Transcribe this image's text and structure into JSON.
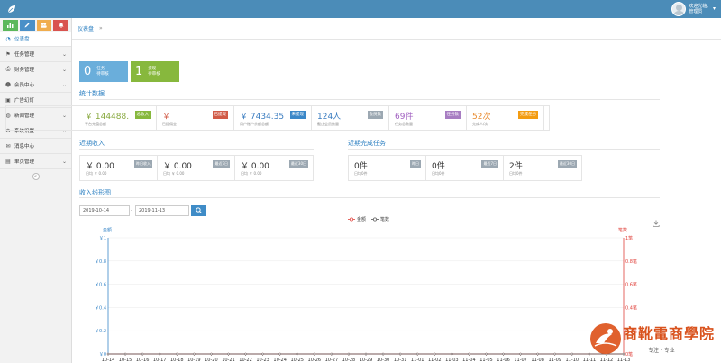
{
  "header": {
    "user_line1": "欢迎光临,",
    "user_line2": "管理员",
    "shortcuts": [
      {
        "icon": "bar-chart-icon",
        "color": "#5cb85c"
      },
      {
        "icon": "pencil-icon",
        "color": "#4a90c8"
      },
      {
        "icon": "users-icon",
        "color": "#f0ad4e"
      },
      {
        "icon": "bell-icon",
        "color": "#d9534f"
      }
    ]
  },
  "sidebar": {
    "items": [
      {
        "label": "仪表盘",
        "icon": "dashboard-icon",
        "active": true
      },
      {
        "label": "任务管理",
        "icon": "flag-icon"
      },
      {
        "label": "财务管理",
        "icon": "print-icon"
      },
      {
        "label": "会员中心",
        "icon": "user-icon"
      },
      {
        "label": "广告幻灯",
        "icon": "image-icon"
      },
      {
        "label": "新闻管理",
        "icon": "globe-icon"
      },
      {
        "label": "系统设置",
        "icon": "gear-icon"
      },
      {
        "label": "消息中心",
        "icon": "message-icon"
      },
      {
        "label": "单页管理",
        "icon": "book-icon"
      }
    ]
  },
  "breadcrumb": {
    "current": "仪表盘",
    "sep": "»"
  },
  "tiles": [
    {
      "value": "0",
      "title": "任务",
      "sub": "待审核",
      "color": "#6aaedb"
    },
    {
      "value": "1",
      "title": "提现",
      "sub": "待审核",
      "color": "#87b83d"
    }
  ],
  "stats": {
    "title": "统计数据",
    "items": [
      {
        "value": "￥ 144488.",
        "sub": "平台充值总额",
        "tag": "总收入",
        "tag_color": "#87b83d",
        "value_color": "#87a83d"
      },
      {
        "value": "￥",
        "sub": "已提佣金",
        "tag": "已提现",
        "tag_color": "#d15b47",
        "value_color": "#d15b47"
      },
      {
        "value": "￥ 7434.35",
        "sub": "用户账户余额总额",
        "tag": "未提现",
        "tag_color": "#3a87c8",
        "value_color": "#3a7cc0"
      },
      {
        "value": "124人",
        "sub": "截止会员数量",
        "tag": "会员数",
        "tag_color": "#9ca8b2",
        "value_color": "#3a7cc0"
      },
      {
        "value": "69件",
        "sub": "任务总数量",
        "tag": "任务数",
        "tag_color": "#a77dc2",
        "value_color": "#a05fc0"
      },
      {
        "value": "52次",
        "sub": "完成人/次",
        "tag": "完成任务",
        "tag_color": "#f39c12",
        "value_color": "#e8892b"
      }
    ]
  },
  "recent_income": {
    "title": "近期收入",
    "items": [
      {
        "value": "￥ 0.00",
        "sub": "日均 ￥ 0.00",
        "tag": "昨日收入"
      },
      {
        "value": "￥ 0.00",
        "sub": "日均 ￥ 0.00",
        "tag": "最近7日"
      },
      {
        "value": "￥ 0.00",
        "sub": "日均 ￥ 0.00",
        "tag": "最近30日"
      }
    ]
  },
  "recent_tasks": {
    "title": "近期完成任务",
    "items": [
      {
        "value": "0件",
        "sub": "日均0件",
        "tag": "昨日"
      },
      {
        "value": "0件",
        "sub": "日均0件",
        "tag": "最近7日"
      },
      {
        "value": "2件",
        "sub": "日均0件",
        "tag": "最近30日"
      }
    ]
  },
  "income_chart_section": {
    "title": "收入线形图",
    "date_from": "2019-10-14",
    "date_to": "2019-11-13",
    "range_sep": "-",
    "search_icon": "search-icon",
    "download_icon": "download-icon"
  },
  "chart_data": {
    "type": "line",
    "x": [
      "10-14",
      "10-15",
      "10-16",
      "10-17",
      "10-18",
      "10-19",
      "10-20",
      "10-21",
      "10-22",
      "10-23",
      "10-24",
      "10-25",
      "10-26",
      "10-27",
      "10-28",
      "10-29",
      "10-30",
      "10-31",
      "11-01",
      "11-02",
      "11-03",
      "11-04",
      "11-05",
      "11-06",
      "11-07",
      "11-08",
      "11-09",
      "11-10",
      "11-11",
      "11-12",
      "11-13"
    ],
    "series": [
      {
        "name": "金额",
        "color": "#e0413b",
        "values": [
          0,
          0,
          0,
          0,
          0,
          0,
          0,
          0,
          0,
          0,
          0,
          0,
          0,
          0,
          0,
          0,
          0,
          0,
          0,
          0,
          0,
          0,
          0,
          0,
          0,
          0,
          0,
          0,
          0,
          0,
          0
        ]
      },
      {
        "name": "笔数",
        "color": "#555555",
        "values": [
          0,
          0,
          0,
          0,
          0,
          0,
          0,
          0,
          0,
          0,
          0,
          0,
          0,
          0,
          0,
          0,
          0,
          0,
          0,
          0,
          0,
          0,
          0,
          0,
          0,
          0,
          0,
          0,
          0,
          0,
          0
        ]
      }
    ],
    "left_axis": {
      "title": "金额",
      "color": "#3a87c8",
      "ylim": [
        0,
        1
      ],
      "ticks": [
        "￥1",
        "￥0.8",
        "￥0.6",
        "￥0.4",
        "￥0.2",
        "￥0"
      ]
    },
    "right_axis": {
      "title": "笔数",
      "color": "#e0413b",
      "ylim": [
        0,
        1
      ],
      "ticks": [
        "1笔",
        "0.8笔",
        "0.6笔",
        "0.4笔",
        "0.2笔",
        "0笔"
      ]
    },
    "legend_position": "top-center"
  },
  "watermark": {
    "name": "商靴電商學院",
    "slogan": "专注 · 专业"
  }
}
